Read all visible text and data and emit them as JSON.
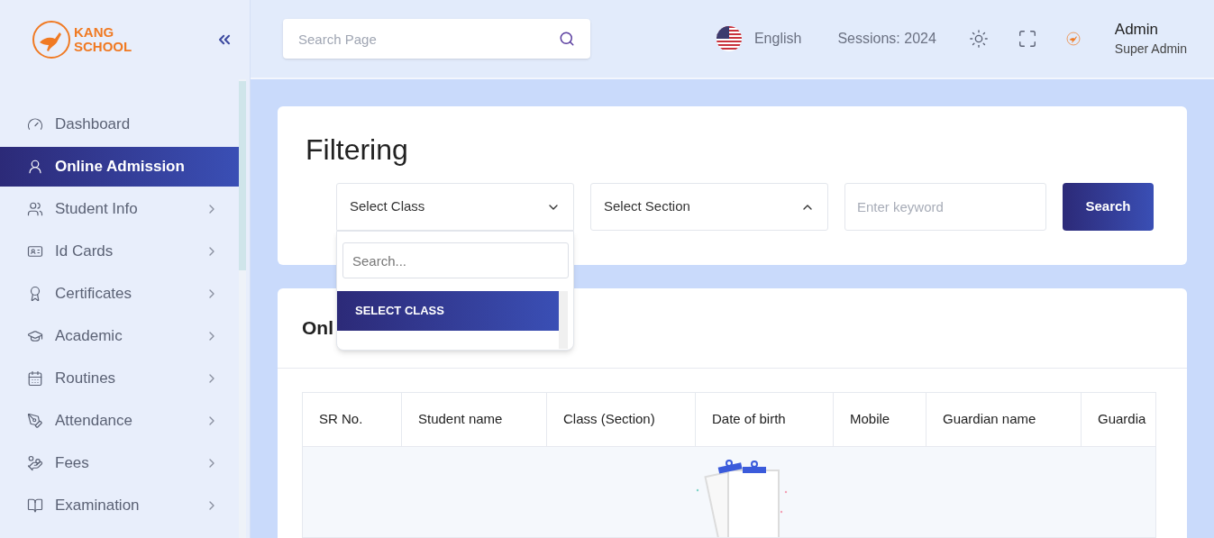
{
  "brand": {
    "line1": "KANG",
    "line2": "SCHOOL"
  },
  "sidebar": {
    "items": [
      {
        "label": "Dashboard",
        "selected": false,
        "expandable": false
      },
      {
        "label": "Online Admission",
        "selected": true,
        "expandable": false
      },
      {
        "label": "Student Info",
        "selected": false,
        "expandable": true
      },
      {
        "label": "Id Cards",
        "selected": false,
        "expandable": true
      },
      {
        "label": "Certificates",
        "selected": false,
        "expandable": true
      },
      {
        "label": "Academic",
        "selected": false,
        "expandable": true
      },
      {
        "label": "Routines",
        "selected": false,
        "expandable": true
      },
      {
        "label": "Attendance",
        "selected": false,
        "expandable": true
      },
      {
        "label": "Fees",
        "selected": false,
        "expandable": true
      },
      {
        "label": "Examination",
        "selected": false,
        "expandable": true
      }
    ]
  },
  "header": {
    "search": {
      "placeholder": "Search Page"
    },
    "language": "English",
    "session": "Sessions: 2024",
    "user": {
      "name": "Admin",
      "role": "Super Admin"
    }
  },
  "filter": {
    "title": "Filtering",
    "class_select": {
      "value": "Select Class",
      "expanded": true,
      "search_placeholder": "Search...",
      "options": [
        {
          "label": "SELECT CLASS",
          "selected": true
        }
      ]
    },
    "section_select": {
      "value": "Select Section",
      "expanded": false
    },
    "keyword": {
      "placeholder": "Enter keyword"
    },
    "search_button": "Search"
  },
  "list": {
    "title": "Onl",
    "table": {
      "columns": [
        "SR No.",
        "Student name",
        "Class (Section)",
        "Date of birth",
        "Mobile",
        "Guardian name",
        "Guardia"
      ]
    }
  }
}
